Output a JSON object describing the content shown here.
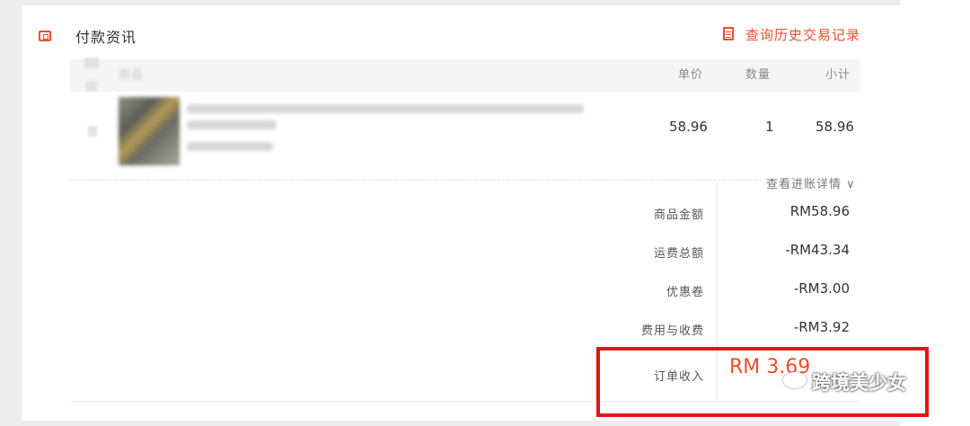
{
  "section": {
    "icon": "payment-card-icon",
    "title": "付款资讯",
    "history_icon": "document-list-icon",
    "history_link": "查询历史交易记录"
  },
  "table": {
    "headers": {
      "product": "商品",
      "unit_price": "单价",
      "quantity": "数量",
      "subtotal": "小计"
    },
    "rows": [
      {
        "unit_price": "58.96",
        "quantity": "1",
        "subtotal": "58.96"
      }
    ]
  },
  "detail_link": "查看进账详情",
  "summary": {
    "items": [
      {
        "label": "商品金额",
        "value": "RM58.96"
      },
      {
        "label": "运费总额",
        "value": "-RM43.34"
      },
      {
        "label": "优惠卷",
        "value": "-RM3.00"
      },
      {
        "label": "费用与收费",
        "value": "-RM3.92"
      }
    ],
    "income_label": "订单收入",
    "income_value": "RM 3.69"
  },
  "watermark": "跨境美少女",
  "colors": {
    "accent": "#ee4d2d",
    "highlight_border": "#e8131a"
  }
}
